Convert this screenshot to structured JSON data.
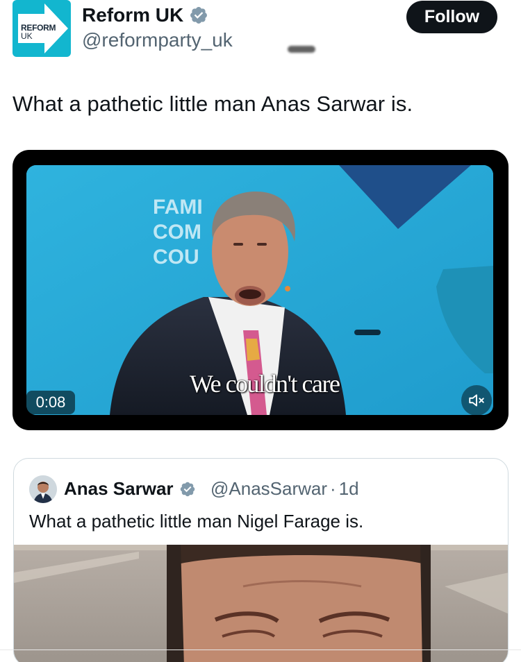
{
  "post": {
    "logo_text_line1": "REFORM",
    "logo_text_line2": "UK",
    "author_name": "Reform UK",
    "author_handle": "@reformparty_uk",
    "follow_label": "Follow",
    "text": "What a pathetic little man Anas Sarwar is."
  },
  "video": {
    "sign_lines": [
      "FAMI",
      "COM",
      "COU"
    ],
    "caption": "We couldn't care",
    "duration": "0:08",
    "muted": true
  },
  "quote": {
    "author_name": "Anas Sarwar",
    "author_handle": "@AnasSarwar",
    "separator": "·",
    "time_ago": "1d",
    "text": "What a pathetic little man Nigel Farage is."
  },
  "colors": {
    "verified_badge": "#829aab",
    "follow_bg": "#0f1419",
    "logo_bg": "#12b6cf",
    "video_bg": "#27a9d6",
    "handle_gray": "#536471"
  },
  "icons": {
    "verified": "verified-badge-icon",
    "mute": "speaker-muted-icon",
    "logo_arrow": "arrow-right-icon"
  }
}
